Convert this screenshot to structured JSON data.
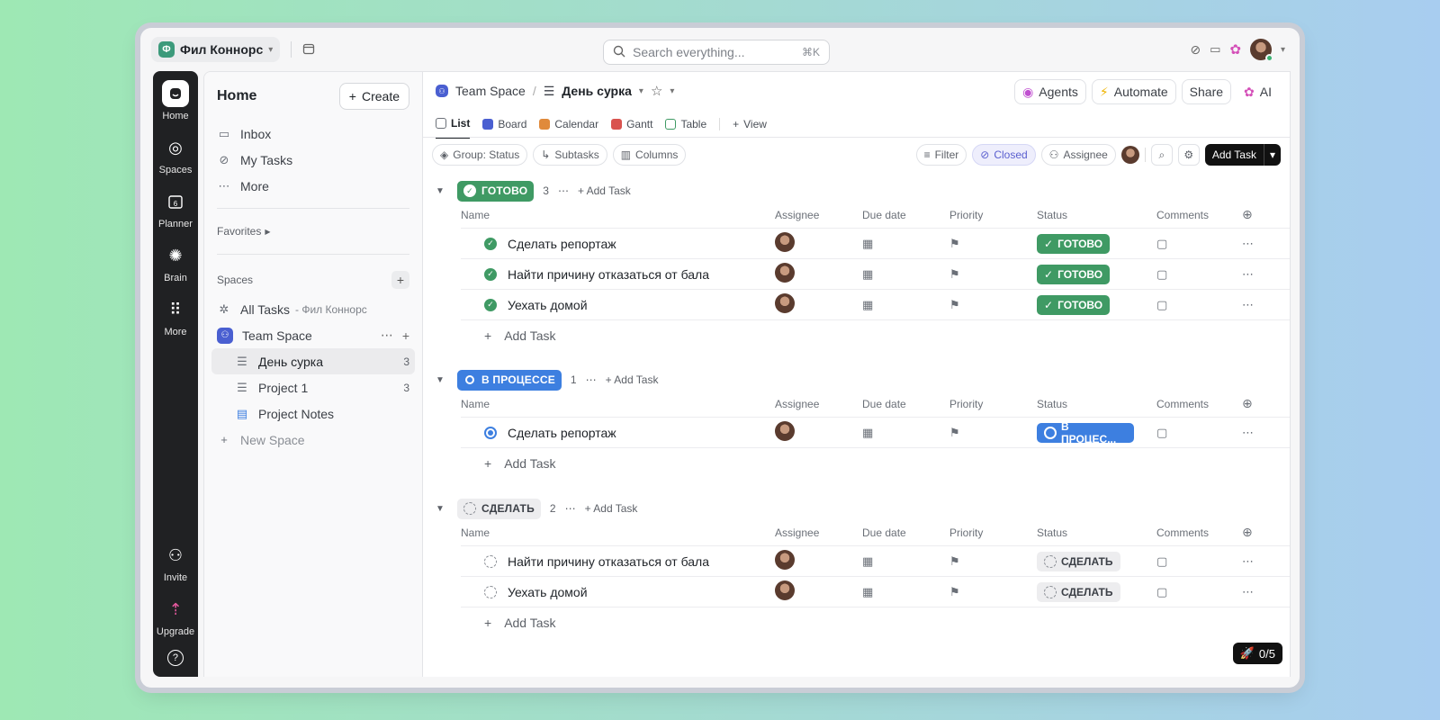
{
  "workspace": {
    "name": "Фил Коннорс",
    "logo_letter": "Ф"
  },
  "search": {
    "placeholder": "Search everything...",
    "shortcut": "⌘K"
  },
  "rail": [
    {
      "label": "Home",
      "icon": "home-icon"
    },
    {
      "label": "Spaces",
      "icon": "planet-icon"
    },
    {
      "label": "Planner",
      "icon": "calendar-icon",
      "day": "6"
    },
    {
      "label": "Brain",
      "icon": "brain-icon"
    },
    {
      "label": "More",
      "icon": "grid-icon"
    }
  ],
  "rail_bottom": [
    {
      "label": "Invite",
      "icon": "invite-icon"
    },
    {
      "label": "Upgrade",
      "icon": "upgrade-icon"
    }
  ],
  "sidebar": {
    "title": "Home",
    "create_label": "Create",
    "nav": [
      {
        "label": "Inbox",
        "icon": "inbox-icon"
      },
      {
        "label": "My Tasks",
        "icon": "check-circle-icon"
      },
      {
        "label": "More",
        "icon": "ellipsis-icon"
      }
    ],
    "favorites_label": "Favorites",
    "spaces_label": "Spaces",
    "all_tasks": {
      "label": "All Tasks",
      "suffix": "- Фил Коннорс"
    },
    "team_space": {
      "label": "Team Space"
    },
    "lists": [
      {
        "label": "День сурка",
        "count": "3"
      },
      {
        "label": "Project 1",
        "count": "3"
      },
      {
        "label": "Project Notes"
      }
    ],
    "new_space_label": "New Space"
  },
  "breadcrumb": {
    "space": "Team Space",
    "list": "День сурка"
  },
  "actions": {
    "agents": "Agents",
    "automate": "Automate",
    "share": "Share",
    "ai": "AI"
  },
  "tabs": [
    {
      "label": "List",
      "color": "#6b7078"
    },
    {
      "label": "Board",
      "color": "#4a5fd1"
    },
    {
      "label": "Calendar",
      "color": "#e08a3b"
    },
    {
      "label": "Gantt",
      "color": "#d9534f"
    },
    {
      "label": "Table",
      "color": "#3f9a64"
    }
  ],
  "add_view_label": "View",
  "toolbar": {
    "group": "Group: Status",
    "subtasks": "Subtasks",
    "columns": "Columns",
    "filter": "Filter",
    "closed": "Closed",
    "assignee": "Assignee",
    "add_task": "Add Task"
  },
  "columns": {
    "name": "Name",
    "assignee": "Assignee",
    "due": "Due date",
    "priority": "Priority",
    "status": "Status",
    "comments": "Comments"
  },
  "groups": [
    {
      "status": "ГОТОВО",
      "kind": "done",
      "count": "3",
      "add_label": "Add Task",
      "tasks": [
        {
          "name": "Сделать репортаж",
          "status": "ГОТОВО"
        },
        {
          "name": "Найти причину отказаться от бала",
          "status": "ГОТОВО"
        },
        {
          "name": "Уехать домой",
          "status": "ГОТОВО"
        }
      ]
    },
    {
      "status": "В ПРОЦЕССЕ",
      "kind": "prog",
      "count": "1",
      "add_label": "Add Task",
      "tasks": [
        {
          "name": "Сделать репортаж",
          "status": "В ПРОЦЕС..."
        }
      ]
    },
    {
      "status": "СДЕЛАТЬ",
      "kind": "todo",
      "count": "2",
      "add_label": "Add Task",
      "tasks": [
        {
          "name": "Найти причину отказаться от бала",
          "status": "СДЕЛАТЬ"
        },
        {
          "name": "Уехать домой",
          "status": "СДЕЛАТЬ"
        }
      ]
    }
  ],
  "add_task_row_label": "Add Task",
  "counter": "0/5"
}
